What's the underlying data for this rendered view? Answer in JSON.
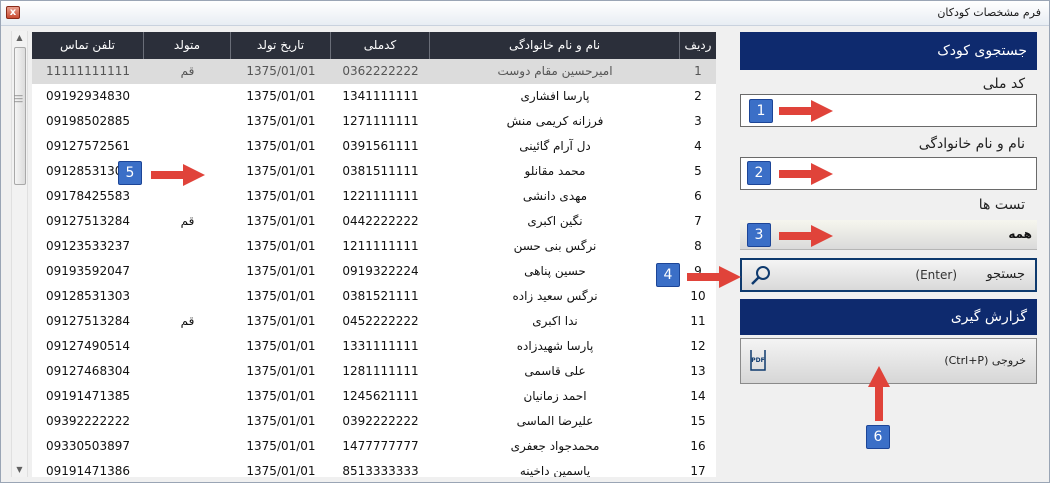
{
  "window": {
    "title": "فرم مشخصات کودکان",
    "close_glyph": "x"
  },
  "grid": {
    "headers": [
      "ردیف",
      "نام و نام خانوادگی",
      "کدملی",
      "تاریخ تولد",
      "متولد",
      "تلفن تماس"
    ],
    "rows": [
      [
        "1",
        "امیرحسین مقام دوست",
        "0362222222",
        "1375/01/01",
        "قم",
        "11111111111"
      ],
      [
        "2",
        "پارسا افشاری",
        "1341111111",
        "1375/01/01",
        "",
        "09192934830"
      ],
      [
        "3",
        "فرزانه کریمی منش",
        "1271111111",
        "1375/01/01",
        "",
        "09198502885"
      ],
      [
        "4",
        "دل آرام گائینی",
        "0391561111",
        "1375/01/01",
        "",
        "09127572561"
      ],
      [
        "5",
        "محمد مقانلو",
        "0381511111",
        "1375/01/01",
        "",
        "09128531303"
      ],
      [
        "6",
        "مهدی دانشی",
        "1221111111",
        "1375/01/01",
        "",
        "09178425583"
      ],
      [
        "7",
        "نگین اکبری",
        "0442222222",
        "1375/01/01",
        "قم",
        "09127513284"
      ],
      [
        "8",
        "نرگس بنی حسن",
        "1211111111",
        "1375/01/01",
        "",
        "09123533237"
      ],
      [
        "9",
        "حسین پناهی",
        "0919322224",
        "1375/01/01",
        "",
        "09193592047"
      ],
      [
        "10",
        "نرگس سعید زاده",
        "0381521111",
        "1375/01/01",
        "",
        "09128531303"
      ],
      [
        "11",
        "ندا اکبری",
        "0452222222",
        "1375/01/01",
        "قم",
        "09127513284"
      ],
      [
        "12",
        "پارسا شهیدزاده",
        "1331111111",
        "1375/01/01",
        "",
        "09127490514"
      ],
      [
        "13",
        "علی قاسمی",
        "1281111111",
        "1375/01/01",
        "",
        "09127468304"
      ],
      [
        "14",
        "احمد زمانیان",
        "1245621111",
        "1375/01/01",
        "",
        "09191471385"
      ],
      [
        "15",
        "علیرضا الماسی",
        "0392222222",
        "1375/01/01",
        "",
        "09392222222"
      ],
      [
        "16",
        "محمدجواد جعفری",
        "1477777777",
        "1375/01/01",
        "",
        "09330503897"
      ],
      [
        "17",
        "یاسمین داخینه",
        "8513333333",
        "1375/01/01",
        "",
        "09191471386"
      ]
    ]
  },
  "side": {
    "search_header": "جستجوی کودک",
    "national_code_label": "کد ملی",
    "national_code_value": "",
    "fullname_label": "نام و نام خانوادگی",
    "fullname_value": "",
    "tests_label": "تست ها",
    "tests_value": "همه",
    "search_label": "جستجو",
    "search_hint": "(Enter)",
    "report_header": "گزارش گیری",
    "export_label": "خروجی (Ctrl+P)",
    "pdf_icon_text": "PDF"
  },
  "badges": [
    "1",
    "2",
    "3",
    "4",
    "5",
    "6"
  ],
  "colors": {
    "header_dark": "#2b2f3a",
    "side_blue": "#0e2a6e",
    "badge_blue": "#3b6fc7",
    "arrow_red": "#e0433a"
  }
}
